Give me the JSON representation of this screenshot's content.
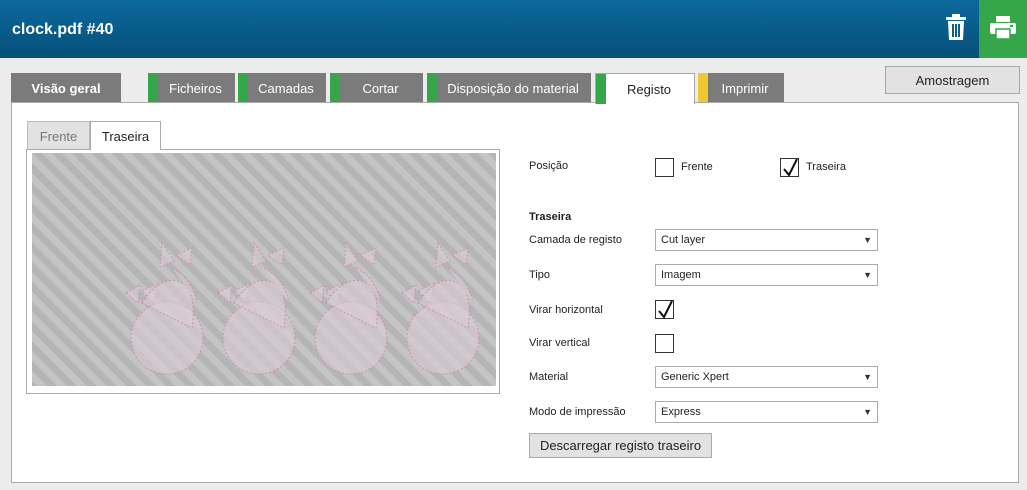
{
  "header": {
    "title": "clock.pdf #40"
  },
  "icons": {
    "trash": "trash-icon",
    "print": "printer-icon",
    "checkmark": "checkmark-icon"
  },
  "colors": {
    "header": "#0a5f8f",
    "print": "#35a64a",
    "tab_green": "#35a64a",
    "tab_yellow": "#f2c531",
    "tab_gray": "#7b7b7b"
  },
  "tabs": [
    {
      "label": "Visão geral",
      "stripe": ""
    },
    {
      "label": "Ficheiros",
      "stripe": "green"
    },
    {
      "label": "Camadas",
      "stripe": "green"
    },
    {
      "label": "Cortar",
      "stripe": "green"
    },
    {
      "label": "Disposição do material",
      "stripe": "green"
    },
    {
      "label": "Registo",
      "stripe": "green",
      "active": true
    },
    {
      "label": "Imprimir",
      "stripe": "yellow"
    }
  ],
  "amostragem_label": "Amostragem",
  "subtabs": {
    "frente": "Frente",
    "traseira": "Traseira",
    "active": "Traseira"
  },
  "form": {
    "posicao": {
      "label": "Posição",
      "frente_label": "Frente",
      "frente_checked": false,
      "traseira_label": "Traseira",
      "traseira_checked": true
    },
    "section_title": "Traseira",
    "camada": {
      "label": "Camada de registo",
      "value": "Cut layer"
    },
    "tipo": {
      "label": "Tipo",
      "value": "Imagem"
    },
    "virar_h": {
      "label": "Virar horizontal",
      "checked": true
    },
    "virar_v": {
      "label": "Virar vertical",
      "checked": false
    },
    "material": {
      "label": "Material",
      "value": "Generic Xpert"
    },
    "modo": {
      "label": "Modo de impressão",
      "value": "Express"
    }
  },
  "download_label": "Descarregar registo traseiro"
}
